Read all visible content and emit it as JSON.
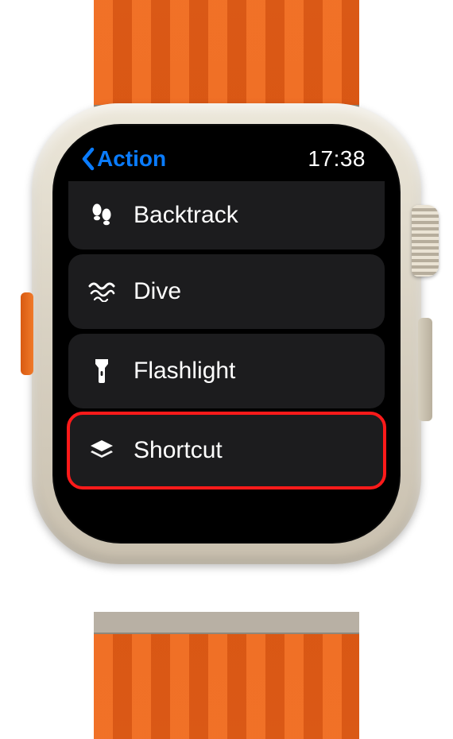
{
  "header": {
    "back_label": "Action",
    "time": "17:38"
  },
  "list": {
    "items": [
      {
        "icon": "footsteps-icon",
        "label": "Backtrack",
        "highlight": false
      },
      {
        "icon": "wave-icon",
        "label": "Dive",
        "highlight": false
      },
      {
        "icon": "flashlight-icon",
        "label": "Flashlight",
        "highlight": false
      },
      {
        "icon": "layers-icon",
        "label": "Shortcut",
        "highlight": true
      }
    ]
  }
}
